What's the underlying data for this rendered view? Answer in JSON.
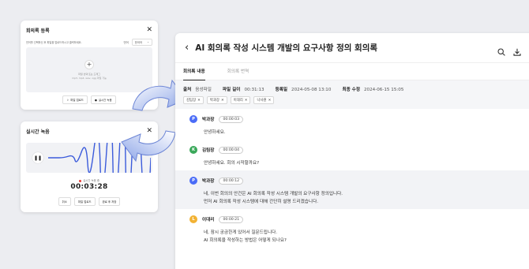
{
  "upload_dialog": {
    "title": "회의록 등록",
    "hint": "언어를 선택하신 후 파일을 업로드하시고 클릭하세요.",
    "language_label": "언어",
    "language_value": "한국어",
    "drop_text": "파일 선택 또는 드래그",
    "formats_text": "mp3, mp4, wav, ogg 파일 가능",
    "file_upload_button": "파일 업로드",
    "realtime_record_button": "실시간 녹음"
  },
  "record_dialog": {
    "title": "실시간 녹음",
    "status": "실시간 녹음 중",
    "elapsed": "00:03:28",
    "buttons": [
      "취소",
      "파일 업로드",
      "완료 후 저장"
    ]
  },
  "detail": {
    "title": "AI 회의록 작성 시스템 개발의 요구사항 정의 회의록",
    "tabs": [
      "회의록 내용",
      "회의록 번역"
    ],
    "meta": {
      "source_label": "출처",
      "source_value": "음성파일",
      "length_label": "파일 길이",
      "length_value": "00:31:13",
      "registered_label": "등록일",
      "registered_value": "2024-05-08 13:10",
      "modified_label": "최종 수정",
      "modified_value": "2024-06-15 15:05"
    },
    "participants": [
      "김팀장",
      "박과장",
      "이대리",
      "나사원"
    ],
    "utterances": [
      {
        "initial": "P",
        "speaker": "박과장",
        "time": "00:00:03",
        "lines": [
          "안녕하세요."
        ],
        "color": "#4a6cf7"
      },
      {
        "initial": "K",
        "speaker": "김팀장",
        "time": "00:00:04",
        "lines": [
          "안녕하세요. 회의 시작할까요?"
        ],
        "color": "#3aa85a"
      },
      {
        "initial": "P",
        "speaker": "박과장",
        "time": "00:00:12",
        "lines": [
          "네, 이번 회의의 안건은 AI 회의록 작성 시스템 개발의 요구사항 정의입니다.",
          "먼저 AI 회의록 작성 시스템에 대해 간단히 설명 드리겠습니다."
        ],
        "color": "#4a6cf7"
      },
      {
        "initial": "L",
        "speaker": "이대리",
        "time": "00:00:21",
        "lines": [
          "네, 잠시 궁금한게 있어서 질문드립니다.",
          "AI 회의록을 작성하는 방법은 어떻게 되나요?"
        ],
        "color": "#f2b233"
      }
    ]
  },
  "icons": {
    "back": "chevron-left-icon",
    "search": "search-icon",
    "download": "download-icon",
    "close": "close-icon",
    "pause": "pause-icon"
  }
}
